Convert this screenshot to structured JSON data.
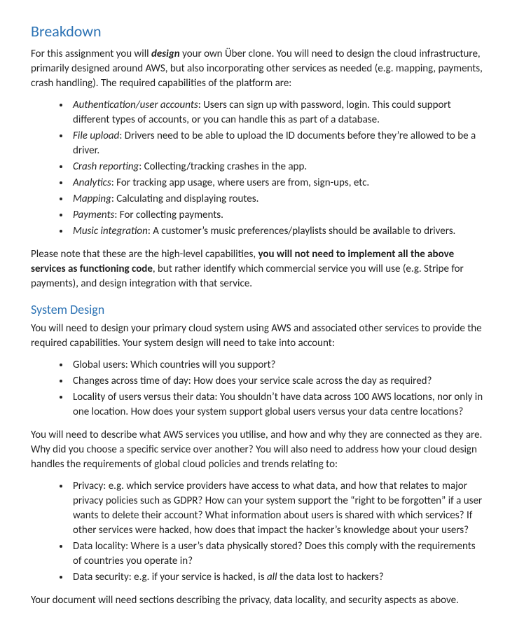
{
  "h_breakdown": "Breakdown",
  "p1a": "For this assignment you will ",
  "p1b": "design",
  "p1c": " your own Über clone. You will need to design the cloud infrastructure, primarily designed around AWS, but also incorporating other services as needed (e.g. mapping, payments, crash handling). The required capabilities of the platform are:",
  "cap1_t": "Authentication/user accounts",
  "cap1_d": ": Users can sign up with password, login. This could support different types of accounts, or you can handle this as part of a database.",
  "cap2_t": "File upload",
  "cap2_d": ": Drivers need to be able to upload the ID documents before they’re allowed to be a driver.",
  "cap3_t": "Crash reporting",
  "cap3_d": ": Collecting/tracking crashes in the app.",
  "cap4_t": "Analytics",
  "cap4_d": ": For tracking app usage, where users are from, sign-ups, etc.",
  "cap5_t": "Mapping",
  "cap5_d": ": Calculating and displaying routes.",
  "cap6_t": "Payments",
  "cap6_d": ": For collecting payments.",
  "cap7_t": "Music integration",
  "cap7_d": ": A customer’s music preferences/playlists should be available to drivers.",
  "p2a": "Please note that these are the high-level capabilities, ",
  "p2b": "you will not need to implement all the above services as functioning code",
  "p2c": ", but rather identify which commercial service you will use (e.g. Stripe for payments), and design integration with that service.",
  "h_system": "System Design",
  "p3": "You will need to design your primary cloud system using AWS and associated other services to provide the required capabilities. Your system design will need to take into account:",
  "sd1": "Global users: Which countries will you support?",
  "sd2": "Changes across time of day: How does your service scale across the day as required?",
  "sd3": "Locality of users versus their data: You shouldn’t have data across 100 AWS locations, nor only in one location. How does your system support global users versus your data centre locations?",
  "p4": "You will need to describe what AWS services you utilise, and how and why they are connected as they are. Why did you choose a specific service over another? You will also need to address how your cloud design handles the requirements of global cloud policies and trends relating to:",
  "pol1": "Privacy: e.g. which service providers have access to what data, and how that relates to major privacy policies such as GDPR? How can your system support the “right to be forgotten” if a user wants to delete their account? What information about users is shared with which services? If other services were hacked, how does that impact the hacker’s knowledge about your users?",
  "pol2": "Data locality: Where is a user’s data physically stored? Does this comply with the requirements of countries you operate in?",
  "pol3a": "Data security: e.g. if your service is hacked, is ",
  "pol3b": "all",
  "pol3c": " the data lost to hackers?",
  "p5": "Your document will need sections describing the privacy, data locality, and security aspects as above."
}
